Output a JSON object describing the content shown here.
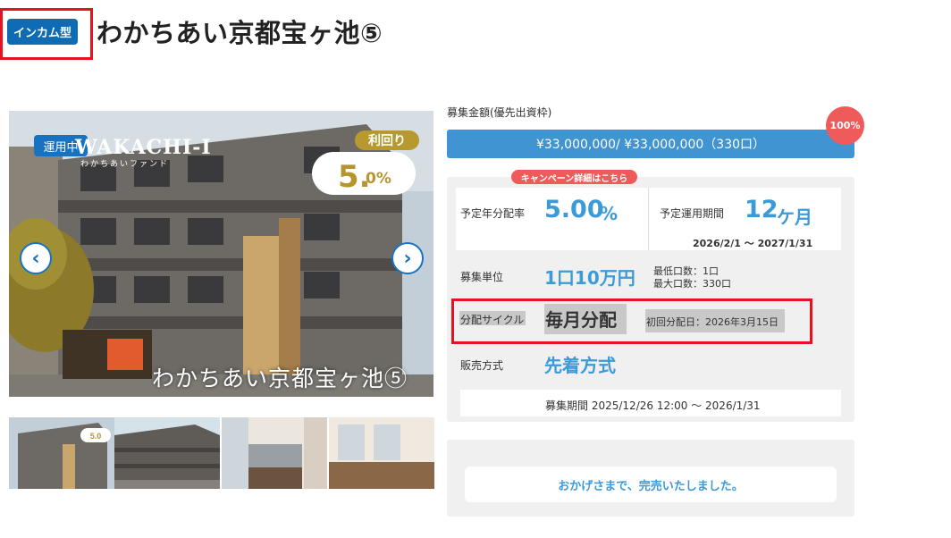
{
  "header": {
    "type_badge": "インカム型",
    "title": "わかちあい京都宝ヶ池⑤"
  },
  "photo": {
    "status_badge": "運用中",
    "logo_text": "WAKACHI-I",
    "logo_sub": "わかちあいファンド",
    "yield_tag": "利回り",
    "yield_value": "5.",
    "yield_unit": "0%",
    "caption": "わかちあい京都宝ヶ池⑤",
    "thumbnail_count": 4
  },
  "raise": {
    "label": "募集金額(優先出資枠)",
    "amount": "¥33,000,000/ ¥33,000,000（330口）",
    "percent": "100%",
    "percent_value": 100
  },
  "campaign": {
    "label": "キャンペーン詳細はこちら"
  },
  "details": {
    "annual_rate_label": "予定年分配率",
    "annual_rate_value": "5.00",
    "annual_rate_unit": "%",
    "term_label": "予定運用期間",
    "term_value": "12",
    "term_unit": "ケ月",
    "term_range": "2026/2/1 ～ 2027/1/31",
    "unit_label": "募集単位",
    "unit_value": "1口10万円",
    "min_units": "最低口数：1口",
    "max_units": "最大口数：330口",
    "cycle_label": "分配サイクル",
    "cycle_value": "毎月分配",
    "first_payment": "初回分配日：2026年3月15日",
    "sales_label": "販売方式",
    "sales_value": "先着方式",
    "period_label": "募集期間",
    "period_value": "2025/12/26 12:00 ～ 2026/1/31"
  },
  "soldout": {
    "message": "おかげさまで、完売いたしました。"
  },
  "colors": {
    "brand_blue": "#1773c2",
    "accent_blue": "#3b9ad8",
    "highlight_red": "#e3141d",
    "badge_red": "#ef5b5b",
    "gold": "#b7952e"
  }
}
